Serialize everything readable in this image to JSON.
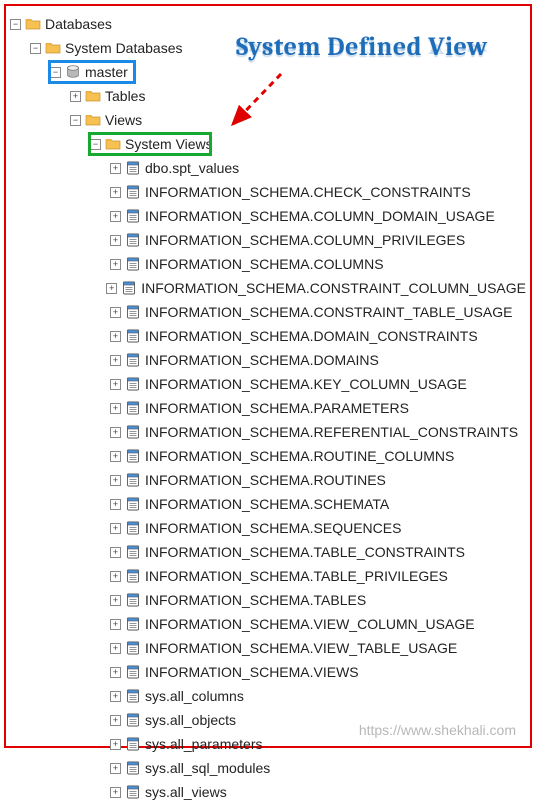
{
  "annotation": {
    "title": "System Defined View",
    "watermark": "https://www.shekhali.com"
  },
  "tree": {
    "root": {
      "label": "Databases",
      "expanded": true,
      "children": [
        {
          "label": "System Databases",
          "expanded": true,
          "children": [
            {
              "label": "master",
              "type": "database",
              "expanded": true,
              "highlight": "blue",
              "children": [
                {
                  "label": "Tables",
                  "expanded": false,
                  "hasChildren": true
                },
                {
                  "label": "Views",
                  "expanded": true,
                  "children": [
                    {
                      "label": "System Views",
                      "expanded": true,
                      "highlight": "green",
                      "items": [
                        "dbo.spt_values",
                        "INFORMATION_SCHEMA.CHECK_CONSTRAINTS",
                        "INFORMATION_SCHEMA.COLUMN_DOMAIN_USAGE",
                        "INFORMATION_SCHEMA.COLUMN_PRIVILEGES",
                        "INFORMATION_SCHEMA.COLUMNS",
                        "INFORMATION_SCHEMA.CONSTRAINT_COLUMN_USAGE",
                        "INFORMATION_SCHEMA.CONSTRAINT_TABLE_USAGE",
                        "INFORMATION_SCHEMA.DOMAIN_CONSTRAINTS",
                        "INFORMATION_SCHEMA.DOMAINS",
                        "INFORMATION_SCHEMA.KEY_COLUMN_USAGE",
                        "INFORMATION_SCHEMA.PARAMETERS",
                        "INFORMATION_SCHEMA.REFERENTIAL_CONSTRAINTS",
                        "INFORMATION_SCHEMA.ROUTINE_COLUMNS",
                        "INFORMATION_SCHEMA.ROUTINES",
                        "INFORMATION_SCHEMA.SCHEMATA",
                        "INFORMATION_SCHEMA.SEQUENCES",
                        "INFORMATION_SCHEMA.TABLE_CONSTRAINTS",
                        "INFORMATION_SCHEMA.TABLE_PRIVILEGES",
                        "INFORMATION_SCHEMA.TABLES",
                        "INFORMATION_SCHEMA.VIEW_COLUMN_USAGE",
                        "INFORMATION_SCHEMA.VIEW_TABLE_USAGE",
                        "INFORMATION_SCHEMA.VIEWS",
                        "sys.all_columns",
                        "sys.all_objects",
                        "sys.all_parameters",
                        "sys.all_sql_modules",
                        "sys.all_views"
                      ]
                    }
                  ]
                }
              ]
            }
          ]
        }
      ]
    }
  }
}
